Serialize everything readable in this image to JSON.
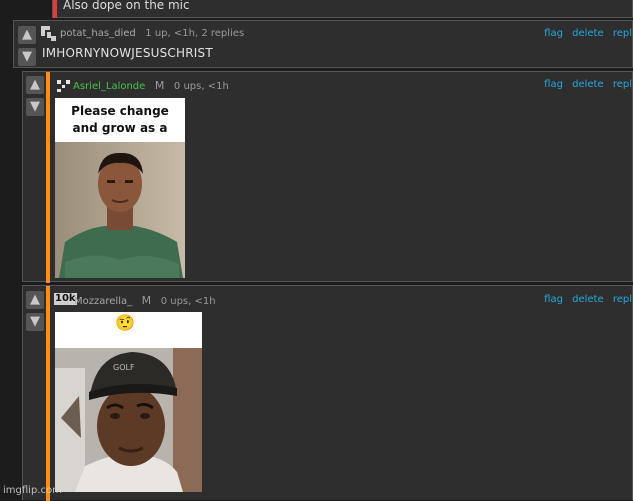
{
  "previous_comment": {
    "text": "Also dope on the mic"
  },
  "comments": [
    {
      "username": "potat_has_died",
      "meta": "1 up, <1h, 2 replies",
      "body": "IMHORNYNOWJESUSCHRIST",
      "links": [
        "flag",
        "delete",
        "repl"
      ]
    },
    {
      "username": "Asriel_Lalonde",
      "badge": "M",
      "meta": "0 ups, <1h",
      "links": [
        "flag",
        "delete",
        "repl"
      ],
      "meme_caption": "Please change and grow as a person"
    },
    {
      "username": "Mozzarella_",
      "badge": "M",
      "avatar_text": "10k",
      "meta": "0 ups, <1h",
      "links": [
        "flag",
        "delete",
        "repl"
      ],
      "emoji": "🤨"
    }
  ],
  "icons": {
    "upvote": "arrow-up-icon",
    "downvote": "arrow-down-icon"
  },
  "colors": {
    "accent_orange": "#ff8c14",
    "accent_red": "#e03c3c",
    "link": "#26a8e0",
    "username_green": "#4bc24b"
  },
  "watermark": "imgflip.com"
}
